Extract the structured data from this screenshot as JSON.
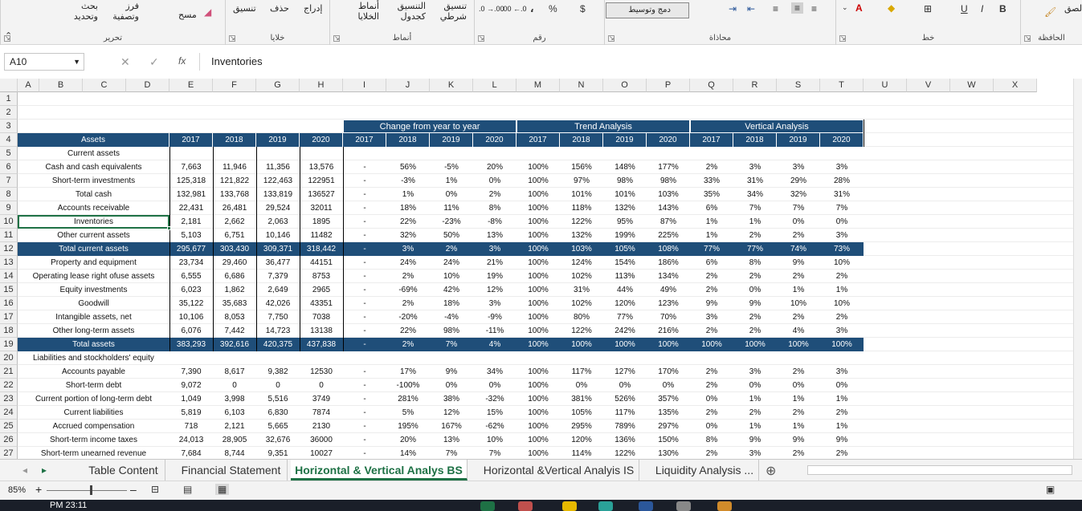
{
  "ribbon": {
    "groups": [
      {
        "label": "الحافظة",
        "l": 1270,
        "w": 77
      },
      {
        "label": "خط",
        "l": 1040,
        "w": 230
      },
      {
        "label": "محاذاة",
        "l": 752,
        "w": 288
      },
      {
        "label": "رقم",
        "l": 590,
        "w": 162
      },
      {
        "label": "أنماط",
        "l": 410,
        "w": 180
      },
      {
        "label": "خلايا",
        "l": 280,
        "w": 130
      },
      {
        "label": "تحرير",
        "l": 0,
        "w": 280
      }
    ],
    "paste_label": "لصق",
    "bold": "B",
    "italic": "I",
    "underline": "U",
    "merge_label": "دمج وتوسيط",
    "percent": "%",
    "currency": "$",
    "comma": "،",
    "dec_inc": ".00 ←.0",
    "dec_dec": ".0 →.00",
    "conditional": "تنسيق شرطي",
    "format_table": "التنسيق كجدول",
    "cell_styles": "أنماط الخلايا",
    "insert": "إدراج",
    "delete": "حذف",
    "format": "تنسيق",
    "sort_filter": "فرز وتصفية",
    "find_select": "بحث وتحديد",
    "clear": "مسح"
  },
  "formula_bar": {
    "name_box": "A10",
    "content": "Inventories",
    "fx": "fx"
  },
  "columns": [
    "A",
    "B",
    "C",
    "D",
    "E",
    "F",
    "G",
    "H",
    "I",
    "J",
    "K",
    "L",
    "M",
    "N",
    "O",
    "P",
    "Q",
    "R",
    "S",
    "T",
    "U",
    "V",
    "W",
    "X"
  ],
  "rows_header": [
    "1",
    "2",
    "3",
    "4",
    "5",
    "6",
    "7",
    "8",
    "9",
    "10",
    "11",
    "12",
    "13",
    "14",
    "15",
    "16",
    "17",
    "18",
    "19",
    "20",
    "21",
    "22",
    "23",
    "24",
    "25",
    "26",
    "27"
  ],
  "bands": {
    "change": "Change from year to year",
    "trend": "Trend Analysis",
    "vertical": "Vertical Analysis"
  },
  "header_row": [
    "Assets",
    "2017",
    "2018",
    "2019",
    "2020",
    "2017",
    "2018",
    "2019",
    "2020",
    "2017",
    "2018",
    "2019",
    "2020",
    "2017",
    "2018",
    "2019",
    "2020"
  ],
  "table": [
    {
      "label": "Current assets",
      "v": [
        "",
        "",
        "",
        "",
        "",
        "",
        "",
        "",
        "",
        "",
        "",
        "",
        "",
        "",
        "",
        ""
      ]
    },
    {
      "label": "Cash and cash equivalents",
      "v": [
        "7,663",
        "11,946",
        "11,356",
        "13,576",
        "-",
        "56%",
        "-5%",
        "20%",
        "100%",
        "156%",
        "148%",
        "177%",
        "2%",
        "3%",
        "3%",
        "3%"
      ]
    },
    {
      "label": "Short-term investments",
      "v": [
        "125,318",
        "121,822",
        "122,463",
        "122951",
        "-",
        "-3%",
        "1%",
        "0%",
        "100%",
        "97%",
        "98%",
        "98%",
        "33%",
        "31%",
        "29%",
        "28%"
      ]
    },
    {
      "label": "Total cash",
      "v": [
        "132,981",
        "133,768",
        "133,819",
        "136527",
        "-",
        "1%",
        "0%",
        "2%",
        "100%",
        "101%",
        "101%",
        "103%",
        "35%",
        "34%",
        "32%",
        "31%"
      ]
    },
    {
      "label": "Accounts receivable",
      "v": [
        "22,431",
        "26,481",
        "29,524",
        "32011",
        "-",
        "18%",
        "11%",
        "8%",
        "100%",
        "118%",
        "132%",
        "143%",
        "6%",
        "7%",
        "7%",
        "7%"
      ]
    },
    {
      "label": "Inventories",
      "v": [
        "2,181",
        "2,662",
        "2,063",
        "1895",
        "-",
        "22%",
        "-23%",
        "-8%",
        "100%",
        "122%",
        "95%",
        "87%",
        "1%",
        "1%",
        "0%",
        "0%"
      ]
    },
    {
      "label": "Other current assets",
      "v": [
        "5,103",
        "6,751",
        "10,146",
        "11482",
        "-",
        "32%",
        "50%",
        "13%",
        "100%",
        "132%",
        "199%",
        "225%",
        "1%",
        "2%",
        "2%",
        "3%"
      ]
    },
    {
      "label": "Total current assets",
      "v": [
        "295,677",
        "303,430",
        "309,371",
        "318,442",
        "-",
        "3%",
        "2%",
        "3%",
        "100%",
        "103%",
        "105%",
        "108%",
        "77%",
        "77%",
        "74%",
        "73%"
      ]
    },
    {
      "label": "Property and equipment",
      "v": [
        "23,734",
        "29,460",
        "36,477",
        "44151",
        "-",
        "24%",
        "24%",
        "21%",
        "100%",
        "124%",
        "154%",
        "186%",
        "6%",
        "8%",
        "9%",
        "10%"
      ]
    },
    {
      "label": "Operating lease right ofuse assets",
      "v": [
        "6,555",
        "6,686",
        "7,379",
        "8753",
        "-",
        "2%",
        "10%",
        "19%",
        "100%",
        "102%",
        "113%",
        "134%",
        "2%",
        "2%",
        "2%",
        "2%"
      ]
    },
    {
      "label": "Equity investments",
      "v": [
        "6,023",
        "1,862",
        "2,649",
        "2965",
        "-",
        "-69%",
        "42%",
        "12%",
        "100%",
        "31%",
        "44%",
        "49%",
        "2%",
        "0%",
        "1%",
        "1%"
      ]
    },
    {
      "label": "Goodwill",
      "v": [
        "35,122",
        "35,683",
        "42,026",
        "43351",
        "-",
        "2%",
        "18%",
        "3%",
        "100%",
        "102%",
        "120%",
        "123%",
        "9%",
        "9%",
        "10%",
        "10%"
      ]
    },
    {
      "label": "Intangible assets, net",
      "v": [
        "10,106",
        "8,053",
        "7,750",
        "7038",
        "-",
        "-20%",
        "-4%",
        "-9%",
        "100%",
        "80%",
        "77%",
        "70%",
        "3%",
        "2%",
        "2%",
        "2%"
      ]
    },
    {
      "label": "Other long-term assets",
      "v": [
        "6,076",
        "7,442",
        "14,723",
        "13138",
        "-",
        "22%",
        "98%",
        "-11%",
        "100%",
        "122%",
        "242%",
        "216%",
        "2%",
        "2%",
        "4%",
        "3%"
      ]
    },
    {
      "label": "Total assets",
      "v": [
        "383,293",
        "392,616",
        "420,375",
        "437,838",
        "-",
        "2%",
        "7%",
        "4%",
        "100%",
        "100%",
        "100%",
        "100%",
        "100%",
        "100%",
        "100%",
        "100%"
      ]
    },
    {
      "label": "Liabilities and stockholders' equity",
      "v": [
        "",
        "",
        "",
        "",
        "",
        "",
        "",
        "",
        "",
        "",
        "",
        "",
        "",
        "",
        "",
        ""
      ]
    },
    {
      "label": "Accounts payable",
      "v": [
        "7,390",
        "8,617",
        "9,382",
        "12530",
        "-",
        "17%",
        "9%",
        "34%",
        "100%",
        "117%",
        "127%",
        "170%",
        "2%",
        "3%",
        "2%",
        "3%"
      ]
    },
    {
      "label": "Short-term debt",
      "v": [
        "9,072",
        "0",
        "0",
        "0",
        "-",
        "-100%",
        "0%",
        "0%",
        "100%",
        "0%",
        "0%",
        "0%",
        "2%",
        "0%",
        "0%",
        "0%"
      ]
    },
    {
      "label": "Current portion of long-term debt",
      "v": [
        "1,049",
        "3,998",
        "5,516",
        "3749",
        "-",
        "281%",
        "38%",
        "-32%",
        "100%",
        "381%",
        "526%",
        "357%",
        "0%",
        "1%",
        "1%",
        "1%"
      ]
    },
    {
      "label": "Current liabilities",
      "v": [
        "5,819",
        "6,103",
        "6,830",
        "7874",
        "-",
        "5%",
        "12%",
        "15%",
        "100%",
        "105%",
        "117%",
        "135%",
        "2%",
        "2%",
        "2%",
        "2%"
      ]
    },
    {
      "label": "Accrued compensation",
      "v": [
        "718",
        "2,121",
        "5,665",
        "2130",
        "-",
        "195%",
        "167%",
        "-62%",
        "100%",
        "295%",
        "789%",
        "297%",
        "0%",
        "1%",
        "1%",
        "1%"
      ]
    },
    {
      "label": "Short-term income taxes",
      "v": [
        "24,013",
        "28,905",
        "32,676",
        "36000",
        "-",
        "20%",
        "13%",
        "10%",
        "100%",
        "120%",
        "136%",
        "150%",
        "8%",
        "9%",
        "9%",
        "9%"
      ]
    },
    {
      "label": "Short-term unearned revenue",
      "v": [
        "7,684",
        "8,744",
        "9,351",
        "10027",
        "-",
        "14%",
        "7%",
        "7%",
        "100%",
        "114%",
        "122%",
        "130%",
        "2%",
        "3%",
        "2%",
        "2%"
      ]
    }
  ],
  "sheet_tabs": [
    "Table Content",
    "Financial Statement",
    "Horizontal & Vertical Analys BS",
    "Horizontal &Vertical Analyis IS",
    "Liquidity Analysis ..."
  ],
  "status": {
    "zoom": "85%"
  },
  "taskbar": {
    "time": "PM 23:11"
  },
  "colors": {
    "band": "#1f4e79",
    "active_tab": "#1e7145"
  }
}
